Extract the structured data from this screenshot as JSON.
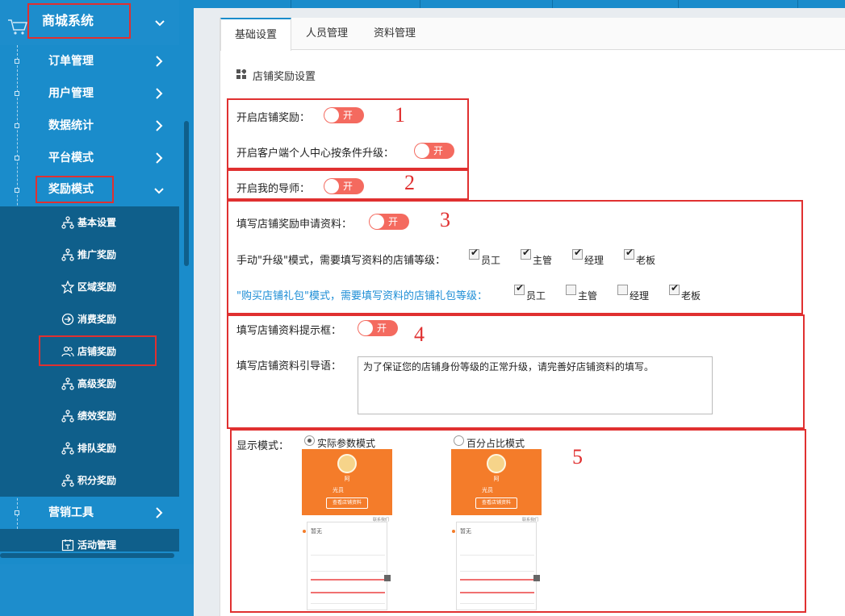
{
  "sidebar": {
    "title": "商城系统",
    "menu": [
      {
        "label": "订单管理"
      },
      {
        "label": "用户管理"
      },
      {
        "label": "数据统计"
      },
      {
        "label": "平台模式"
      },
      {
        "label": "奖励模式"
      }
    ],
    "submenu": [
      {
        "label": "基本设置",
        "icon": "tree-icon"
      },
      {
        "label": "推广奖励",
        "icon": "tree-icon"
      },
      {
        "label": "区域奖励",
        "icon": "star-icon"
      },
      {
        "label": "消费奖励",
        "icon": "arrow-circle-icon"
      },
      {
        "label": "店铺奖励",
        "icon": "users-icon"
      },
      {
        "label": "高级奖励",
        "icon": "tree-icon"
      },
      {
        "label": "绩效奖励",
        "icon": "tree-icon"
      },
      {
        "label": "排队奖励",
        "icon": "tree-icon"
      },
      {
        "label": "积分奖励",
        "icon": "tree-icon"
      }
    ],
    "menu_bottom": {
      "label": "营销工具"
    },
    "sub_bottom": {
      "label": "活动管理"
    }
  },
  "tabs": [
    "基础设置",
    "人员管理",
    "资料管理"
  ],
  "section_title": "店铺奖励设置",
  "toggle_text": "开",
  "annotations": [
    "1",
    "2",
    "3",
    "4",
    "5"
  ],
  "settings": {
    "open_store_reward": "开启店铺奖励：",
    "client_upgrade": "开启客户端个人中心按条件升级：",
    "open_mentor": "开启我的导师：",
    "fill_apply": "填写店铺奖励申请资料：",
    "manual_upgrade": "手动\"升级\"模式，需要填写资料的店铺等级：",
    "buy_package": "\"购买店铺礼包\"模式，需要填写资料的店铺礼包等级：",
    "tip_box": "填写店铺资料提示框：",
    "guide_text_label": "填写店铺资料引导语：",
    "guide_text_value": "为了保证您的店铺身份等级的正常升级，请完善好店铺资料的填写。",
    "display_mode": "显示模式：",
    "mode_actual": "实际参数模式",
    "mode_percent": "百分占比模式"
  },
  "levels_manual": [
    {
      "label": "员工",
      "checked": true
    },
    {
      "label": "主管",
      "checked": true
    },
    {
      "label": "经理",
      "checked": true
    },
    {
      "label": "老板",
      "checked": true
    }
  ],
  "levels_package": [
    {
      "label": "员工",
      "checked": true
    },
    {
      "label": "主管",
      "checked": false
    },
    {
      "label": "经理",
      "checked": false
    },
    {
      "label": "老板",
      "checked": true
    }
  ],
  "phone": {
    "name": "阿",
    "level": "光员",
    "button": "查看店铺资料",
    "card_title": "暂无",
    "top_note": "联系我们"
  },
  "colors": {
    "accent": "#1a8ccb",
    "toggle": "#f46a5f",
    "annotation": "#e03030",
    "phone_header": "#f47c2a"
  }
}
